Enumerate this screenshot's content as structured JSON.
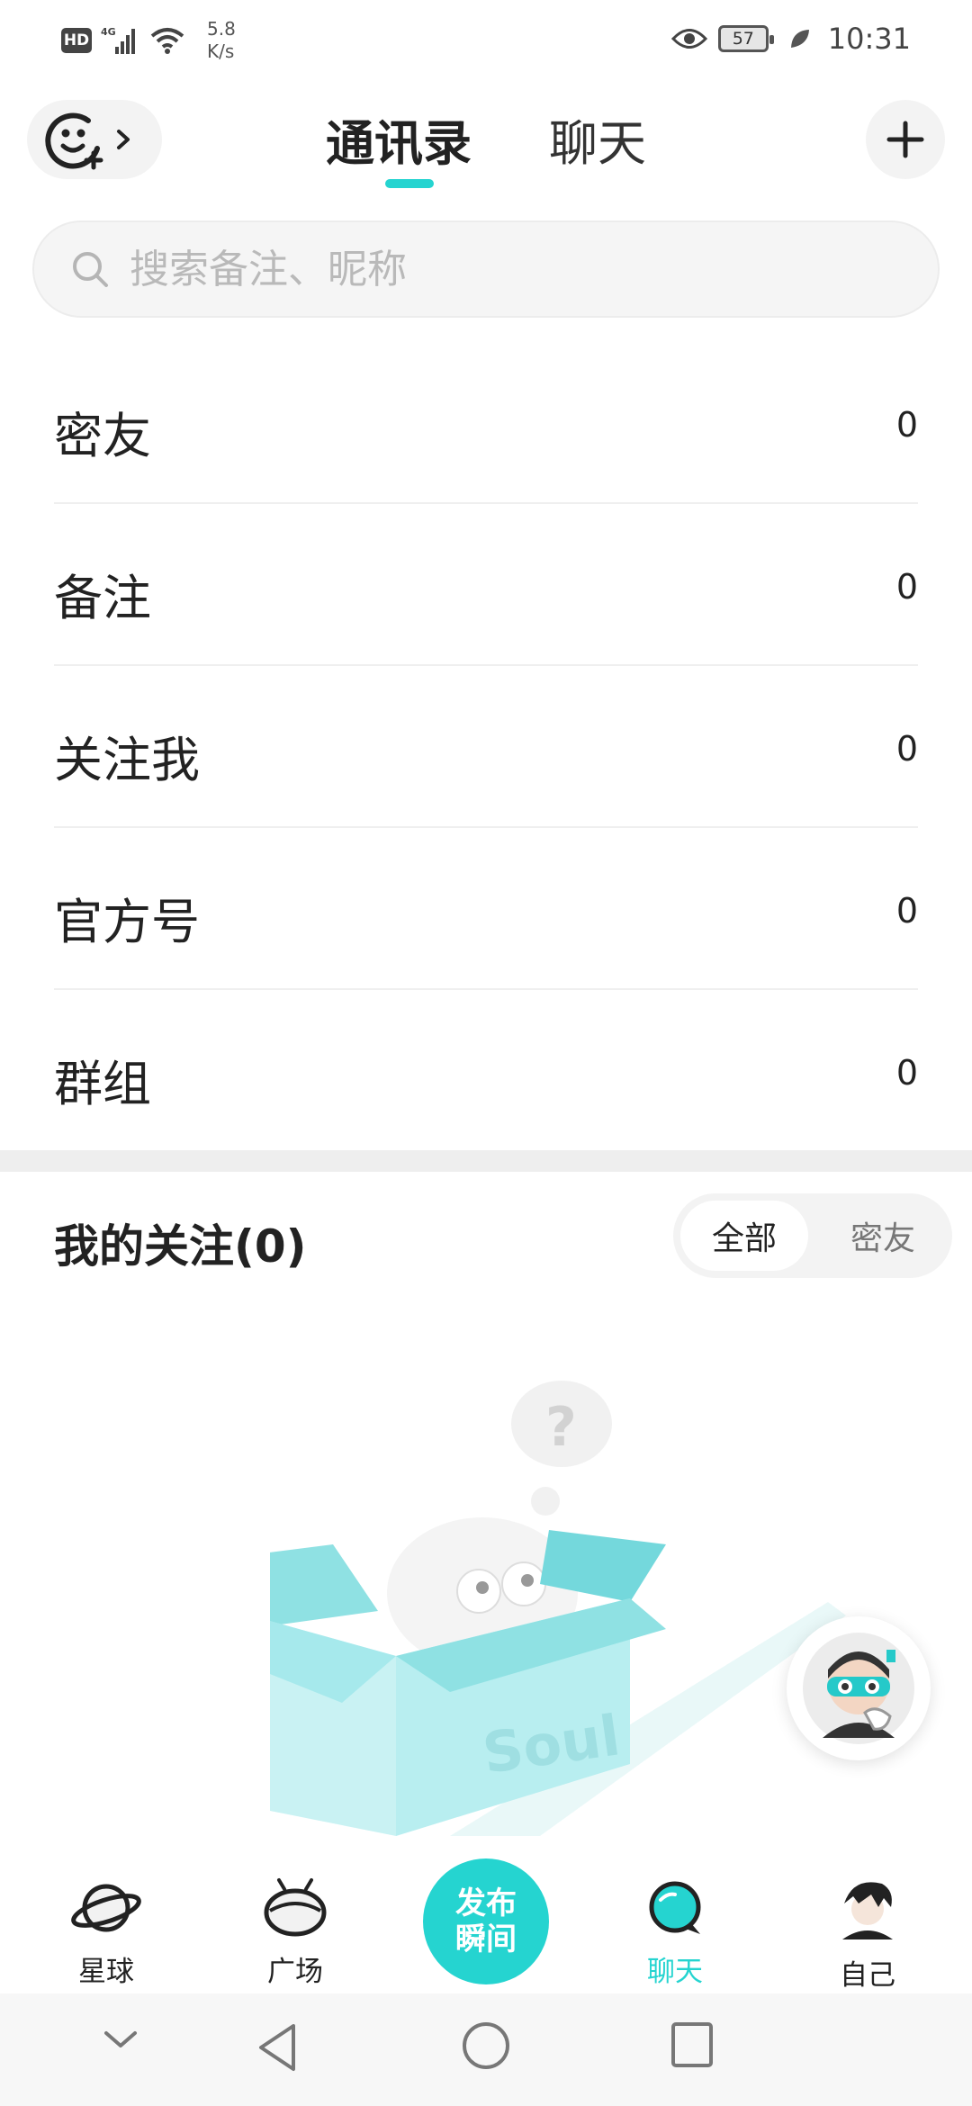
{
  "status_bar": {
    "hd": "HD",
    "signal_type": "4G",
    "net_speed_value": "5.8",
    "net_speed_unit": "K/s",
    "battery": "57",
    "time": "10:31"
  },
  "header": {
    "tabs": [
      {
        "label": "通讯录",
        "active": true
      },
      {
        "label": "聊天",
        "active": false
      }
    ],
    "accent_color": "#25d4d0"
  },
  "search": {
    "placeholder": "搜索备注、昵称"
  },
  "contact_groups": [
    {
      "label": "密友",
      "count": "0"
    },
    {
      "label": "备注",
      "count": "0"
    },
    {
      "label": "关注我",
      "count": "0"
    },
    {
      "label": "官方号",
      "count": "0"
    },
    {
      "label": "群组",
      "count": "0"
    }
  ],
  "my_follows": {
    "title": "我的关注(0)",
    "filters": [
      {
        "label": "全部",
        "selected": true
      },
      {
        "label": "密友",
        "selected": false
      }
    ],
    "illustration_text": "Soul"
  },
  "bottom_nav": {
    "items": [
      {
        "label": "星球",
        "icon": "planet-icon",
        "active": false
      },
      {
        "label": "广场",
        "icon": "square-icon",
        "active": false
      },
      {
        "label": "聊天",
        "icon": "chat-icon",
        "active": true
      },
      {
        "label": "自己",
        "icon": "self-avatar-icon",
        "active": false
      }
    ],
    "publish": {
      "line1": "发布",
      "line2": "瞬间"
    }
  }
}
